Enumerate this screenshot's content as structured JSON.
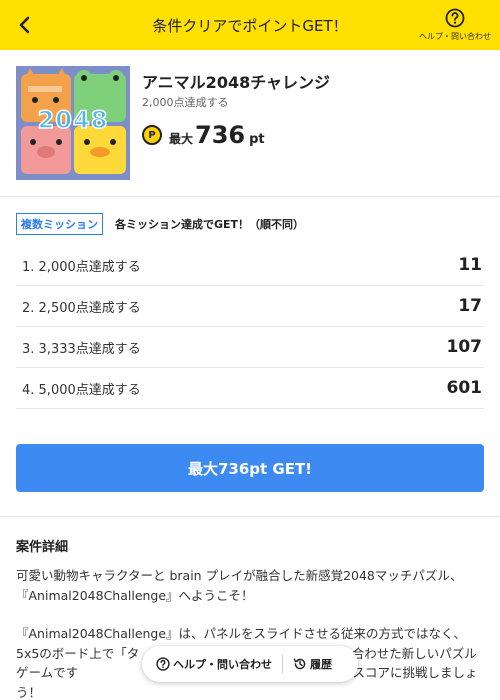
{
  "header": {
    "title": "条件クリアでポイントGET！",
    "help_label": "ヘルプ・問い合わせ",
    "back_icon": "chevron-left-icon",
    "help_icon": "question-circle-icon",
    "background": "#ffe000"
  },
  "app": {
    "name": "アニマル2048チャレンジ",
    "subtitle": "2,000点達成する",
    "icon_number": "2048",
    "coin_symbol": "P",
    "max_label": "最大",
    "max_value": "736",
    "max_unit": "pt"
  },
  "missions": {
    "badge": "複数ミッション",
    "description": "各ミッション達成でGET！（順不同）",
    "items": [
      {
        "label": "1. 2,000点達成する",
        "points": "11"
      },
      {
        "label": "2. 2,500点達成する",
        "points": "17"
      },
      {
        "label": "3. 3,333点達成する",
        "points": "107"
      },
      {
        "label": "4. 5,000点達成する",
        "points": "601"
      }
    ]
  },
  "cta": {
    "label": "最大736pt GET!",
    "color": "#3d8bf2"
  },
  "details": {
    "title": "案件詳細",
    "paragraphs": [
      "可愛い動物キャラクターと brain プレイが融合した新感覚2048マッチパズル、『Animal2048Challenge』へようこそ！",
      "『Animal2048Challenge』は、パネルをスライドさせる従来の方式ではなく、5x5のボード上で「タ　　　　　　　　　　　　　」を組み合わせた新しいパズルゲームです　　　　　　　　　　　　　物を作り出し、ハイスコアに挑戦しましょう！"
    ]
  },
  "floating_bar": {
    "help_label": "ヘルプ・問い合わせ",
    "history_label": "履歴"
  }
}
